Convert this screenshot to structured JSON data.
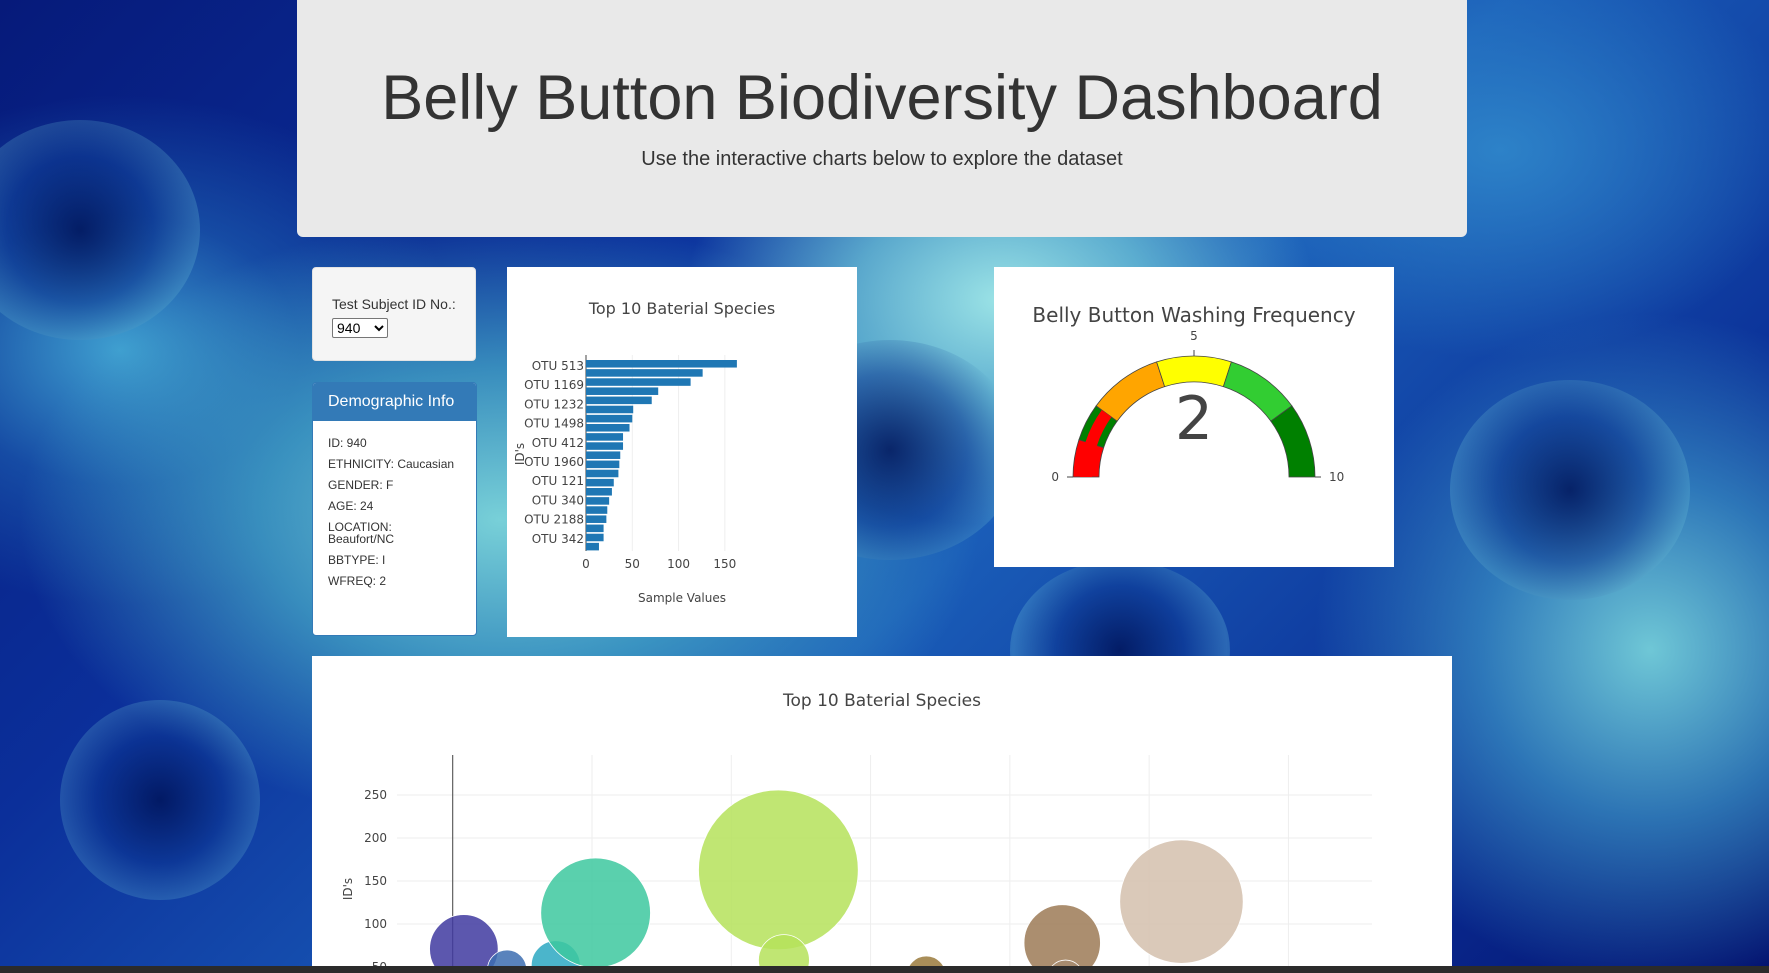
{
  "header": {
    "title": "Belly Button Biodiversity Dashboard",
    "subtitle": "Use the interactive charts below to explore the dataset"
  },
  "selector": {
    "label": "Test Subject ID No.:",
    "selected": "940"
  },
  "demographics": {
    "heading": "Demographic Info",
    "rows": [
      "ID: 940",
      "ETHNICITY: Caucasian",
      "GENDER: F",
      "AGE: 24",
      "LOCATION: Beaufort/NC",
      "BBTYPE: I",
      "WFREQ: 2"
    ]
  },
  "chart_data": [
    {
      "type": "bar",
      "orientation": "horizontal",
      "title": "Top 10 Baterial Species",
      "xlabel": "Sample Values",
      "ylabel": "ID's",
      "xlim": [
        0,
        175
      ],
      "x_ticks": [
        0,
        50,
        100,
        150
      ],
      "y_tick_labels": [
        "OTU 513",
        "OTU 1169",
        "OTU 1232",
        "OTU 1498",
        "OTU 412",
        "OTU 1960",
        "OTU 121",
        "OTU 340",
        "OTU 2188",
        "OTU 342"
      ],
      "values": [
        163,
        126,
        113,
        78,
        71,
        51,
        50,
        47,
        40,
        40,
        37,
        36,
        35,
        30,
        28,
        25,
        23,
        22,
        19,
        19,
        14
      ],
      "color": "#1f77b4"
    },
    {
      "type": "gauge",
      "title": "Belly Button Washing Frequency",
      "value": 2,
      "range": [
        0,
        10
      ],
      "tick_labels": [
        "0",
        "5",
        "10"
      ],
      "steps": [
        {
          "from": 0,
          "to": 1,
          "color": "#ff0000"
        },
        {
          "from": 1,
          "to": 2,
          "color": "#008000"
        },
        {
          "from": 2,
          "to": 4,
          "color": "#ffa500"
        },
        {
          "from": 4,
          "to": 6,
          "color": "#ffff00"
        },
        {
          "from": 6,
          "to": 8,
          "color": "#32cd32"
        },
        {
          "from": 8,
          "to": 10,
          "color": "#008000"
        }
      ],
      "bar_color": "#ff0000"
    },
    {
      "type": "scatter",
      "title": "Top 10 Baterial Species",
      "ylabel": "ID's",
      "y_ticks": [
        50,
        100,
        150,
        200,
        250
      ],
      "ylim": [
        50,
        295
      ],
      "xlim": [
        -200,
        3300
      ],
      "points": [
        {
          "x": 40,
          "y": 71,
          "size": 70,
          "color": "#3f3aa0"
        },
        {
          "x": 195,
          "y": 47,
          "size": 40,
          "color": "#3c6db0"
        },
        {
          "x": 370,
          "y": 52,
          "size": 50,
          "color": "#2ba8c2"
        },
        {
          "x": 513,
          "y": 113,
          "size": 112,
          "color": "#3dc89f"
        },
        {
          "x": 1169,
          "y": 163,
          "size": 163,
          "color": "#b5e25b"
        },
        {
          "x": 1189,
          "y": 58,
          "size": 52,
          "color": "#b5e25b"
        },
        {
          "x": 1700,
          "y": 40,
          "size": 40,
          "color": "#9a7a3c"
        },
        {
          "x": 2188,
          "y": 78,
          "size": 78,
          "color": "#9c7a56"
        },
        {
          "x": 2200,
          "y": 37,
          "size": 37,
          "color": "#a58b70"
        },
        {
          "x": 2616,
          "y": 126,
          "size": 126,
          "color": "#d3c0ad"
        }
      ]
    }
  ]
}
